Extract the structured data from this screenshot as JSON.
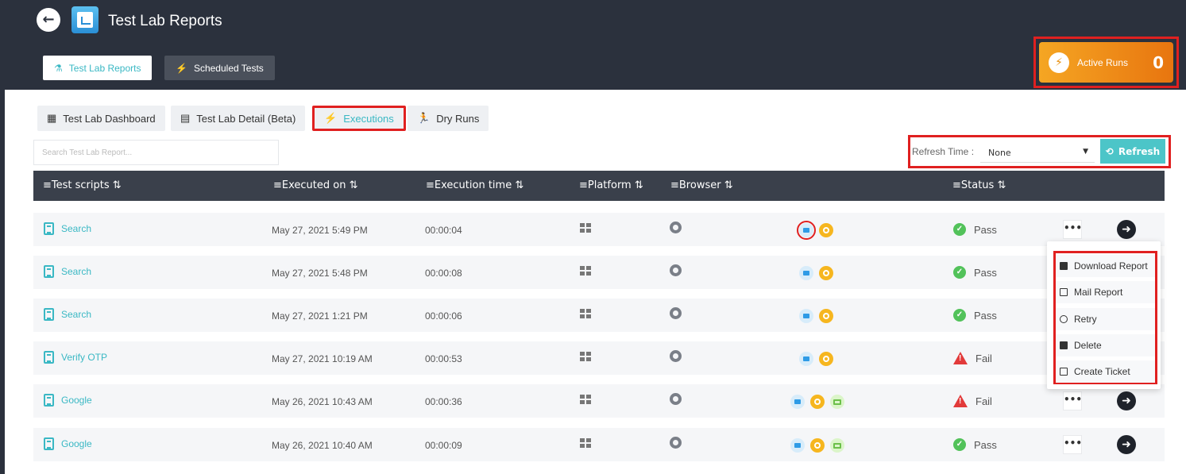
{
  "header": {
    "title": "Test Lab Reports",
    "back_icon": "←",
    "tabs": [
      {
        "label": "Test Lab Reports",
        "icon": "⚗"
      },
      {
        "label": "Scheduled Tests",
        "icon": "⚡"
      }
    ],
    "active_runs": {
      "label": "Active Runs",
      "count": "0",
      "icon": "⚡"
    }
  },
  "nav_tabs": [
    {
      "label": "Test Lab Dashboard",
      "icon": "▦"
    },
    {
      "label": "Test Lab Detail  (Beta)",
      "icon": "▤"
    },
    {
      "label": "Executions",
      "icon": "⚡"
    },
    {
      "label": "Dry Runs",
      "icon": "🏃"
    }
  ],
  "search": {
    "placeholder": "Search Test Lab Report..."
  },
  "refresh": {
    "label": "Refresh Time :",
    "selected": "None",
    "caret": "▼",
    "button": "Refresh",
    "button_icon": "⟲"
  },
  "table": {
    "headers": [
      "≡Test scripts ⇅",
      "≡Executed on ⇅",
      "≡Execution time ⇅",
      "≡Platform ⇅",
      "≡Browser ⇅",
      "≡Status ⇅"
    ],
    "rows": [
      {
        "script": "Search",
        "executed": "May 27, 2021 5:49 PM",
        "time": "00:00:04",
        "status": "Pass"
      },
      {
        "script": "Search",
        "executed": "May 27, 2021 5:48 PM",
        "time": "00:00:08",
        "status": "Pass"
      },
      {
        "script": "Search",
        "executed": "May 27, 2021 1:21 PM",
        "time": "00:00:06",
        "status": "Pass"
      },
      {
        "script": "Verify OTP",
        "executed": "May 27, 2021 10:19 AM",
        "time": "00:00:53",
        "status": "Fail"
      },
      {
        "script": "Google",
        "executed": "May 26, 2021 10:43 AM",
        "time": "00:00:36",
        "status": "Fail"
      },
      {
        "script": "Google",
        "executed": "May 26, 2021 10:40 AM",
        "time": "00:00:09",
        "status": "Pass"
      }
    ],
    "more_label": "•••",
    "go_icon": "➜",
    "pass_icon": "✓",
    "fail_icon": "!"
  },
  "context_menu": {
    "items": [
      "Download Report",
      "Mail Report",
      "Retry",
      "Delete",
      "Create Ticket"
    ]
  },
  "colors": {
    "accent": "#3ab8c4",
    "header_bg": "#2b313d",
    "pass": "#52c25a",
    "fail": "#e23a3a",
    "highlight": "#e02020"
  }
}
